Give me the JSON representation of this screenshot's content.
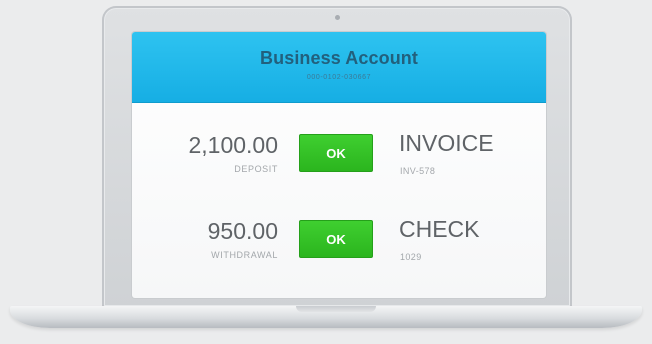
{
  "account": {
    "title": "Business Account",
    "number": "000-0102-030667"
  },
  "transactions": [
    {
      "amount": "2,100.00",
      "type": "DEPOSIT",
      "button_label": "OK",
      "ref_title": "INVOICE",
      "ref_number": "INV-578"
    },
    {
      "amount": "950.00",
      "type": "WITHDRAWAL",
      "button_label": "OK",
      "ref_title": "CHECK",
      "ref_number": "1029"
    }
  ],
  "colors": {
    "header_blue": "#1fb8eb",
    "ok_green": "#34c226",
    "text_gray": "#5f6367",
    "subtext_gray": "#a3a7ab"
  }
}
